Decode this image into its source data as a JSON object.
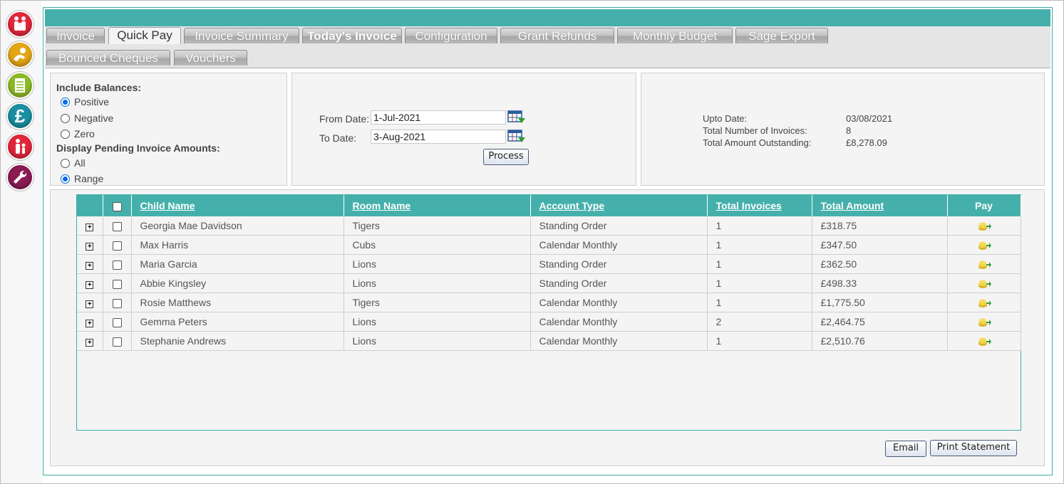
{
  "sidebar": {
    "items": [
      {
        "name": "family-icon",
        "color": "#e1273b"
      },
      {
        "name": "baby-icon",
        "color": "#e3a617"
      },
      {
        "name": "register-icon",
        "color": "#8dbb26"
      },
      {
        "name": "pound-icon",
        "color": "#1b8fa0"
      },
      {
        "name": "parent-child-icon",
        "color": "#e1273b"
      },
      {
        "name": "wrench-icon",
        "color": "#8b1a55"
      }
    ]
  },
  "tabs": {
    "row1": [
      "Invoice",
      "Quick Pay",
      "Invoice Summary",
      "Today's Invoice",
      "Configuration",
      "Grant Refunds",
      "Monthly Budget",
      "Sage Export"
    ],
    "row2": [
      "Bounced Cheques",
      "Vouchers"
    ],
    "active": "Quick Pay"
  },
  "filters": {
    "include_balances_label": "Include Balances:",
    "balances": [
      {
        "label": "Positive",
        "checked": true
      },
      {
        "label": "Negative",
        "checked": false
      },
      {
        "label": "Zero",
        "checked": false
      }
    ],
    "pending_label": "Display Pending Invoice Amounts:",
    "pending": [
      {
        "label": "All",
        "checked": false
      },
      {
        "label": "Range",
        "checked": true
      }
    ]
  },
  "dates": {
    "from_label": "From Date:",
    "from_value": "1-Jul-2021",
    "to_label": "To Date:",
    "to_value": "3-Aug-2021",
    "process_label": "Process"
  },
  "summary": {
    "upto_label": "Upto Date:",
    "upto_value": "03/08/2021",
    "count_label": "Total Number of Invoices:",
    "count_value": "8",
    "outstanding_label": "Total Amount Outstanding:",
    "outstanding_value": "£8,278.09"
  },
  "table": {
    "headers": [
      "Child Name",
      "Room Name",
      "Account Type",
      "Total Invoices",
      "Total Amount",
      "Pay"
    ],
    "rows": [
      {
        "child": "Georgia Mae Davidson",
        "room": "Tigers",
        "account": "Standing Order",
        "invoices": "1",
        "amount": "£318.75"
      },
      {
        "child": "Max Harris",
        "room": "Cubs",
        "account": "Calendar Monthly",
        "invoices": "1",
        "amount": "£347.50"
      },
      {
        "child": "Maria Garcia",
        "room": "Lions",
        "account": "Standing Order",
        "invoices": "1",
        "amount": "£362.50"
      },
      {
        "child": "Abbie Kingsley",
        "room": "Lions",
        "account": "Standing Order",
        "invoices": "1",
        "amount": "£498.33"
      },
      {
        "child": "Rosie Matthews",
        "room": "Tigers",
        "account": "Calendar Monthly",
        "invoices": "1",
        "amount": "£1,775.50"
      },
      {
        "child": "Gemma Peters",
        "room": "Lions",
        "account": "Calendar Monthly",
        "invoices": "2",
        "amount": "£2,464.75"
      },
      {
        "child": "Stephanie Andrews",
        "room": "Lions",
        "account": "Calendar Monthly",
        "invoices": "1",
        "amount": "£2,510.76"
      }
    ],
    "expand_symbol": "+"
  },
  "actions": {
    "email_label": "Email",
    "print_label": "Print Statement"
  },
  "colors": {
    "accent": "#45b0ab",
    "panel_bg": "#f4f4f4"
  }
}
